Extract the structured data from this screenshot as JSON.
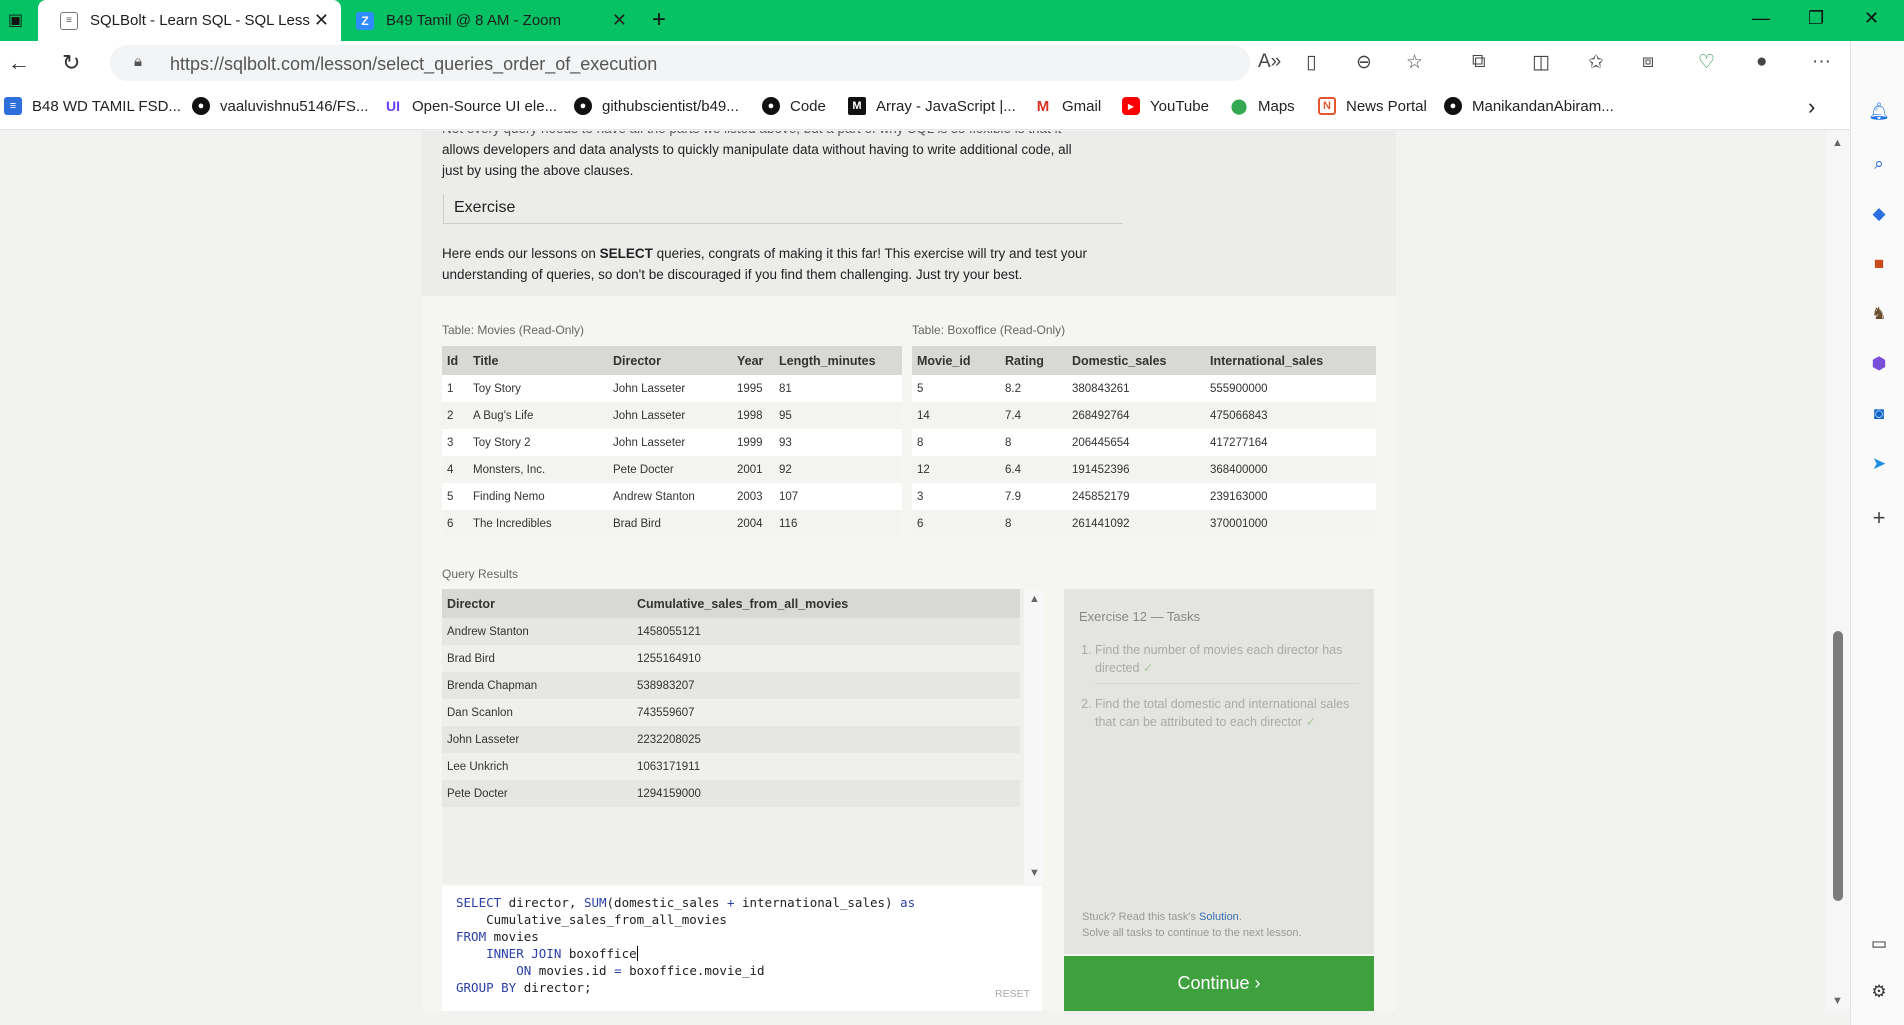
{
  "tabs": [
    {
      "title": "SQLBolt - Learn SQL - SQL Lesso",
      "active": true
    },
    {
      "title": "B49 Tamil @ 8 AM - Zoom",
      "active": false
    }
  ],
  "address": {
    "url": "https://sqlbolt.com/lesson/select_queries_order_of_execution"
  },
  "bookmarks": [
    {
      "label": "B48 WD TAMIL FSD..."
    },
    {
      "label": "vaaluvishnu5146/FS..."
    },
    {
      "label": "Open-Source UI ele..."
    },
    {
      "label": "githubscientist/b49..."
    },
    {
      "label": "Code"
    },
    {
      "label": "Array - JavaScript |..."
    },
    {
      "label": "Gmail"
    },
    {
      "label": "YouTube"
    },
    {
      "label": "Maps"
    },
    {
      "label": "News Portal"
    },
    {
      "label": "ManikandanAbiram..."
    }
  ],
  "lesson": {
    "para_line1": "Not every query needs to have all the parts we listed above, but a part of why SQL is so flexible is that it",
    "para_line2": "allows developers and data analysts to quickly manipulate data without having to write additional code, all",
    "para_line3": "just by using the above clauses.",
    "exercise_heading": "Exercise",
    "exercise_line1_pre": "Here ends our lessons on ",
    "exercise_line1_kw": "SELECT",
    "exercise_line1_post": " queries, congrats of making it this far! This exercise will try and test your",
    "exercise_line2": "understanding of queries, so don't be discouraged if you find them challenging. Just try your best."
  },
  "movies": {
    "label": "Table: Movies (Read-Only)",
    "headers": [
      "Id",
      "Title",
      "Director",
      "Year",
      "Length_minutes"
    ],
    "rows": [
      [
        "1",
        "Toy Story",
        "John Lasseter",
        "1995",
        "81"
      ],
      [
        "2",
        "A Bug's Life",
        "John Lasseter",
        "1998",
        "95"
      ],
      [
        "3",
        "Toy Story 2",
        "John Lasseter",
        "1999",
        "93"
      ],
      [
        "4",
        "Monsters, Inc.",
        "Pete Docter",
        "2001",
        "92"
      ],
      [
        "5",
        "Finding Nemo",
        "Andrew Stanton",
        "2003",
        "107"
      ],
      [
        "6",
        "The Incredibles",
        "Brad Bird",
        "2004",
        "116"
      ]
    ]
  },
  "boxoffice": {
    "label": "Table: Boxoffice (Read-Only)",
    "headers": [
      "Movie_id",
      "Rating",
      "Domestic_sales",
      "International_sales"
    ],
    "rows": [
      [
        "5",
        "8.2",
        "380843261",
        "555900000"
      ],
      [
        "14",
        "7.4",
        "268492764",
        "475066843"
      ],
      [
        "8",
        "8",
        "206445654",
        "417277164"
      ],
      [
        "12",
        "6.4",
        "191452396",
        "368400000"
      ],
      [
        "3",
        "7.9",
        "245852179",
        "239163000"
      ],
      [
        "6",
        "8",
        "261441092",
        "370001000"
      ]
    ]
  },
  "results": {
    "label": "Query Results",
    "headers": [
      "Director",
      "Cumulative_sales_from_all_movies"
    ],
    "rows": [
      [
        "Andrew Stanton",
        "1458055121"
      ],
      [
        "Brad Bird",
        "1255164910"
      ],
      [
        "Brenda Chapman",
        "538983207"
      ],
      [
        "Dan Scanlon",
        "743559607"
      ],
      [
        "John Lasseter",
        "2232208025"
      ],
      [
        "Lee Unkrich",
        "1063171911"
      ],
      [
        "Pete Docter",
        "1294159000"
      ]
    ]
  },
  "editor": {
    "l1_kw": "SELECT",
    "l1_a": " director, ",
    "l1_fn": "SUM",
    "l1_b": "(domestic_sales ",
    "l1_op": "+",
    "l1_c": " international_sales) ",
    "l1_as": "as",
    "l2": "    Cumulative_sales_from_all_movies",
    "l3_kw": "FROM",
    "l3_a": " movies",
    "l4_kw": "    INNER JOIN",
    "l4_a": " boxoffice",
    "l5_kw": "        ON",
    "l5_a": " movies.id ",
    "l5_op": "=",
    "l5_b": " boxoffice.movie_id",
    "l6_kw": "GROUP BY",
    "l6_a": " director;",
    "reset": "RESET"
  },
  "tasks": {
    "heading": "Exercise 12 — Tasks",
    "items": [
      {
        "text": "Find the number of movies each director has directed",
        "check": "✓"
      },
      {
        "text": "Find the total domestic and international sales that can be attributed to each director",
        "check": "✓"
      }
    ],
    "stuck_pre": "Stuck? Read this task's ",
    "stuck_link": "Solution",
    "stuck_post": ".",
    "stuck_line2": "Solve all tasks to continue to the next lesson."
  },
  "continue_label": "Continue ›",
  "colors": {
    "titlebar": "#06c264",
    "continue": "#3fa13e",
    "link": "#3a6fb0",
    "keyword": "#2a3fa8"
  }
}
